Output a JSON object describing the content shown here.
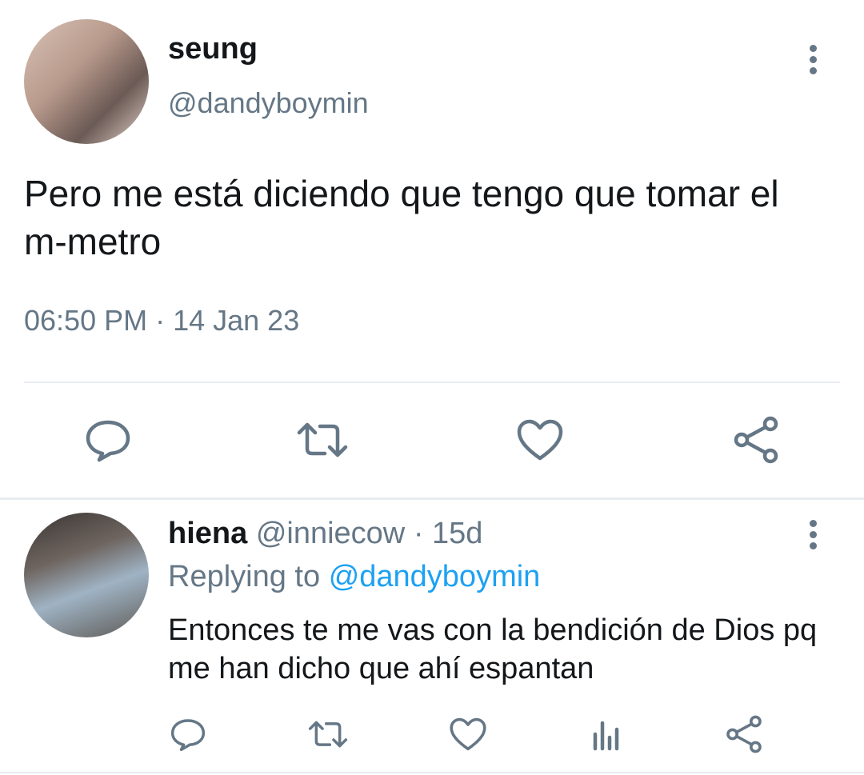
{
  "tweet": {
    "author_name": "seung",
    "author_handle": "@dandyboymin",
    "text": "Pero me está diciendo que tengo que tomar el m-metro",
    "timestamp": "06:50 PM · 14 Jan 23",
    "actions": [
      "reply-icon",
      "retweet-icon",
      "like-icon",
      "share-icon"
    ]
  },
  "reply": {
    "author_name": "hiena",
    "author_handle": "@inniecow",
    "age": "· 15d",
    "replying_label": "Replying to",
    "replying_handle": "@dandyboymin",
    "text": "Entonces te me vas con la bendición de Dios pq me han dicho que ahí espantan",
    "actions": [
      "reply-icon",
      "retweet-icon",
      "like-icon",
      "stats-icon",
      "share-icon"
    ]
  },
  "colors": {
    "text": "#14171a",
    "secondary": "#657786",
    "link": "#1da1f2",
    "divider": "#e6ecf0"
  }
}
